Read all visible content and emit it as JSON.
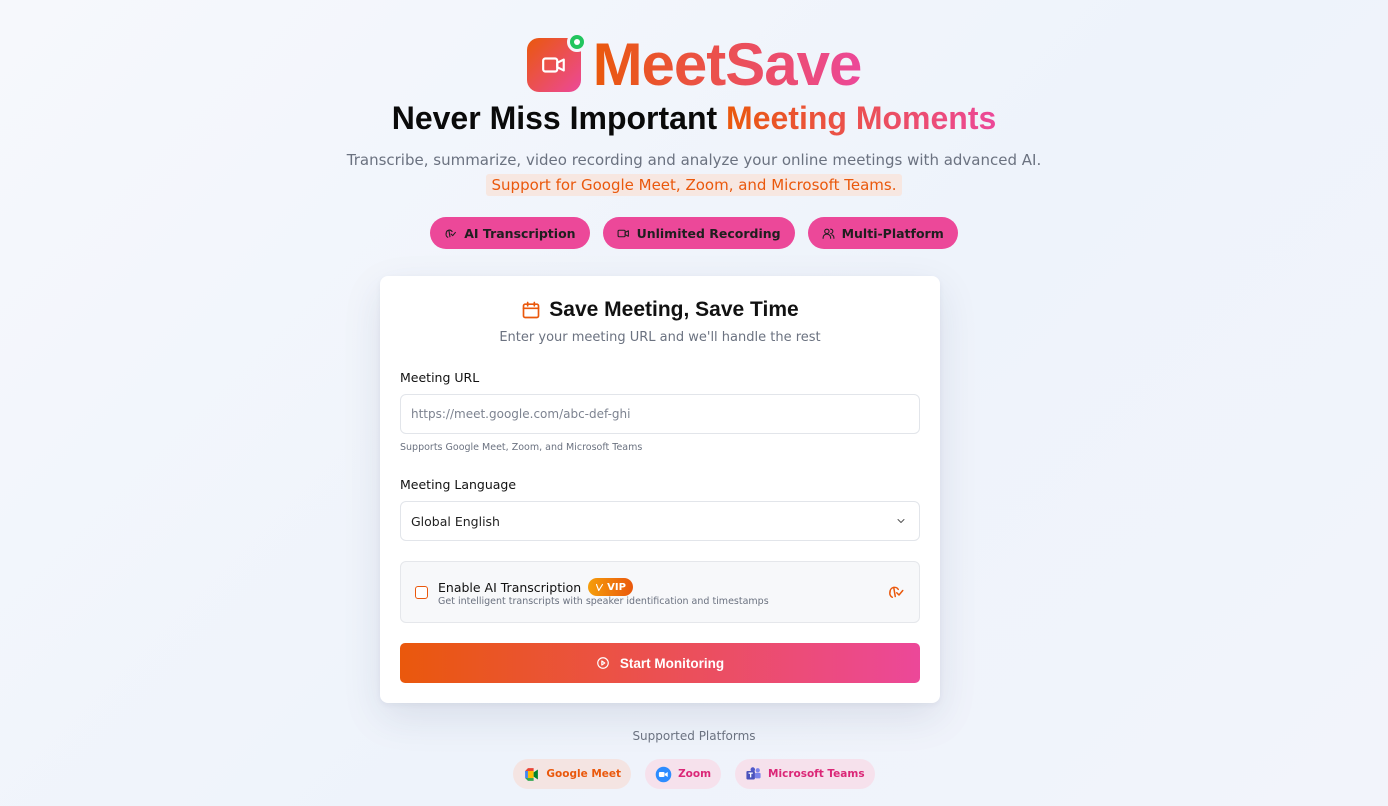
{
  "brand": {
    "name": "MeetSave"
  },
  "hero": {
    "headline_plain": "Never Miss Important",
    "headline_accent": "Meeting Moments",
    "subtitle_main": "Transcribe, summarize, video recording and analyze your online meetings with advanced AI.",
    "subtitle_highlight": "Support for Google Meet, Zoom, and Microsoft Teams."
  },
  "features": [
    {
      "label": "AI Transcription",
      "icon": "ai-voice-icon"
    },
    {
      "label": "Unlimited Recording",
      "icon": "video-icon"
    },
    {
      "label": "Multi-Platform",
      "icon": "users-icon"
    }
  ],
  "form": {
    "title": "Save Meeting, Save Time",
    "subtitle": "Enter your meeting URL and we'll handle the rest",
    "url_label": "Meeting URL",
    "url_placeholder": "https://meet.google.com/abc-def-ghi",
    "url_value": "",
    "url_hint": "Supports Google Meet, Zoom, and Microsoft Teams",
    "language_label": "Meeting Language",
    "language_value": "Global English",
    "ai_title": "Enable AI Transcription",
    "ai_badge": "VIP",
    "ai_desc": "Get intelligent transcripts with speaker identification and timestamps",
    "ai_checked": false,
    "start_label": "Start Monitoring"
  },
  "platforms": {
    "title": "Supported Platforms",
    "items": [
      {
        "label": "Google Meet",
        "icon": "google-meet-icon"
      },
      {
        "label": "Zoom",
        "icon": "zoom-icon"
      },
      {
        "label": "Microsoft Teams",
        "icon": "microsoft-teams-icon"
      }
    ]
  },
  "colors": {
    "accent_start": "#ea580c",
    "accent_end": "#ec4899",
    "online_dot": "#22c55e"
  }
}
